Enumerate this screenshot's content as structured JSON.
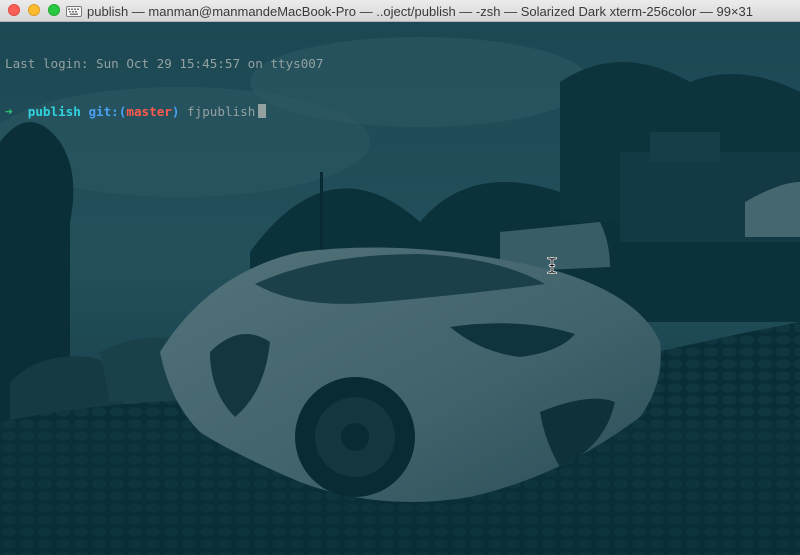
{
  "window": {
    "title": "publish — manman@manmandeMacBook-Pro — ..oject/publish — -zsh — Solarized Dark xterm-256color — 99×31"
  },
  "terminal": {
    "last_login": "Last login: Sun Oct 29 15:45:57 on ttys007",
    "prompt": {
      "arrow": "➜",
      "directory": "publish",
      "git_prefix": "git:(",
      "branch": "master",
      "git_suffix": ")",
      "command": "fjpublish"
    }
  },
  "theme": {
    "background": "#0f3a45",
    "text": "#93a1a1",
    "arrow": "#2ecc71",
    "directory": "#2fd4e0",
    "git": "#4aa0f0",
    "branch": "#ff5a4e"
  },
  "icons": {
    "window_icon": "keyboard-icon",
    "pointer": "ibeam-cursor-icon"
  }
}
